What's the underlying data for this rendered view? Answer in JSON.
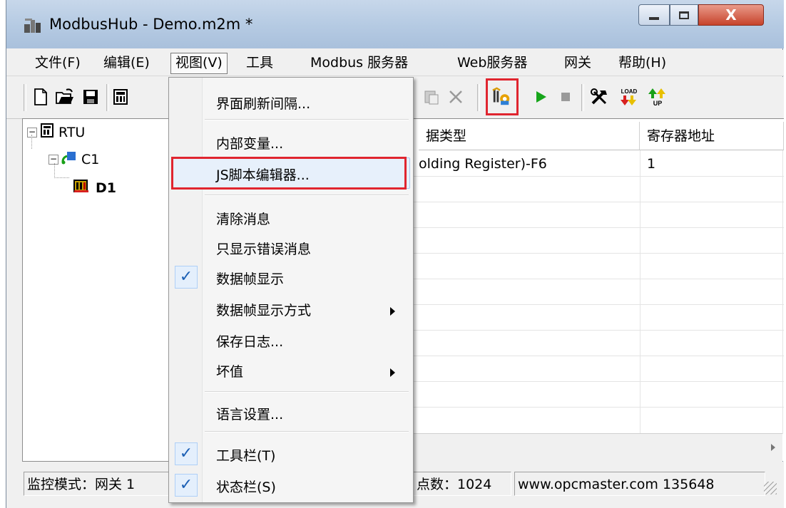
{
  "window": {
    "title": "ModbusHub - Demo.m2m *",
    "close_glyph": "X"
  },
  "menubar": {
    "items": [
      "文件(F)",
      "编辑(E)",
      "视图(V)",
      "工具",
      "Modbus 服务器",
      "Web服务器",
      "网关",
      "帮助(H)"
    ]
  },
  "toolbar": {
    "icons": [
      "new-file-icon",
      "open-folder-icon",
      "save-icon",
      "device-icon",
      "paste-icon",
      "delete-icon",
      "js-script-icon",
      "run-icon",
      "stop-icon",
      "tools-icon",
      "load-icon",
      "upload-icon"
    ],
    "load_text": "LOAD",
    "up_text": "UP"
  },
  "tree": {
    "root": "RTU",
    "channel": "C1",
    "device": "D1"
  },
  "grid": {
    "columns": [
      "据类型",
      "寄存器地址"
    ],
    "rows": [
      [
        "olding Register)-F6",
        "1"
      ]
    ]
  },
  "view_menu": {
    "items": [
      {
        "label": "界面刷新间隔...",
        "checked": false,
        "submenu": false
      },
      {
        "label": "内部变量...",
        "checked": false,
        "submenu": false
      },
      {
        "label": "JS脚本编辑器...",
        "checked": false,
        "submenu": false
      },
      {
        "label": "清除消息",
        "checked": false,
        "submenu": false
      },
      {
        "label": "只显示错误消息",
        "checked": false,
        "submenu": false
      },
      {
        "label": "数据帧显示",
        "checked": true,
        "submenu": false
      },
      {
        "label": "数据帧显示方式",
        "checked": false,
        "submenu": true
      },
      {
        "label": "保存日志...",
        "checked": false,
        "submenu": false
      },
      {
        "label": "坏值",
        "checked": false,
        "submenu": true
      },
      {
        "label": "语言设置...",
        "checked": false,
        "submenu": false
      },
      {
        "label": "工具栏(T)",
        "checked": true,
        "submenu": false
      },
      {
        "label": "状态栏(S)",
        "checked": true,
        "submenu": false
      }
    ],
    "check_glyph": "✓"
  },
  "statusbar": {
    "mode": "监控模式：网关 1",
    "points": "点数：1024",
    "website": "www.opcmaster.com 135648"
  },
  "colors": {
    "highlight_red": "#e0252f",
    "check_blue": "#1b5fb4",
    "run_green": "#16a51a"
  }
}
